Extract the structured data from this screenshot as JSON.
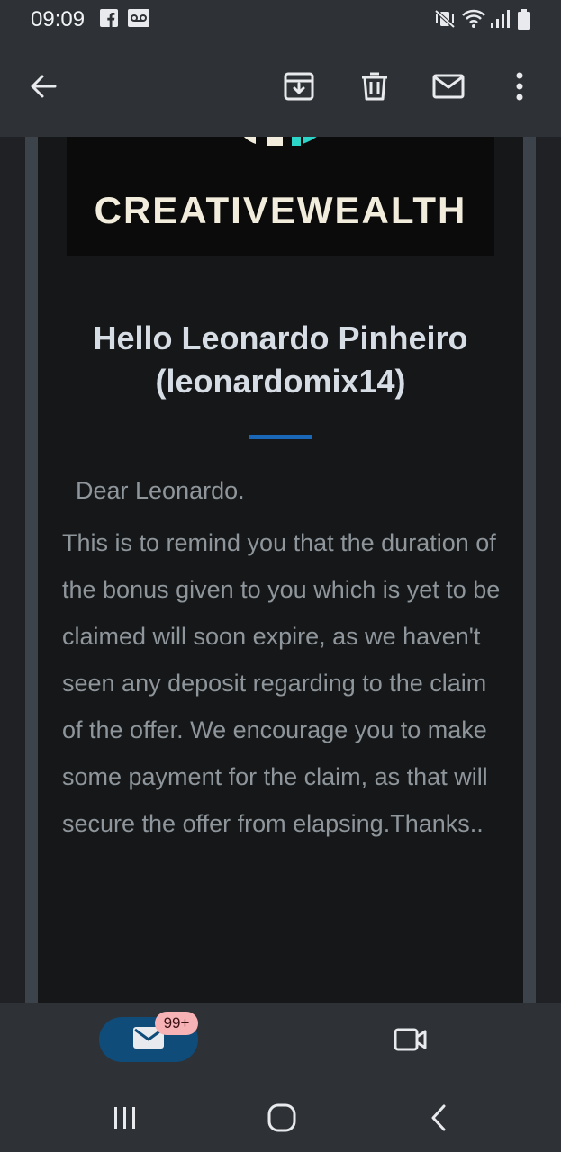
{
  "status_bar": {
    "time": "09:09",
    "left_icons": [
      "facebook-icon",
      "voicemail-icon"
    ],
    "right_icons": [
      "mute-vibrate-icon",
      "wifi-icon",
      "signal-icon",
      "battery-icon"
    ]
  },
  "app_bar": {
    "icons": [
      "back-arrow-icon",
      "archive-icon",
      "delete-icon",
      "mark-unread-icon",
      "more-vert-icon"
    ]
  },
  "email": {
    "banner_brand": "CREATIVEWEALTH",
    "greeting": "Hello Leonardo Pinheiro (leonardomix14)",
    "salutation": "Dear Leonardo.",
    "body": "This is to remind you that the duration of the bonus given to you which is yet to be claimed will soon expire, as we haven't seen any deposit regarding to the claim of the offer. We encourage you to make some payment for the claim, as that will secure the offer from elapsing.Thanks..",
    "accent_color": "#1a67b8"
  },
  "bottom_nav": {
    "mail_badge": "99+",
    "icons": [
      "mail-icon",
      "video-camera-icon"
    ]
  },
  "system_nav": {
    "icons": [
      "recent-apps-icon",
      "home-icon",
      "system-back-icon"
    ]
  }
}
